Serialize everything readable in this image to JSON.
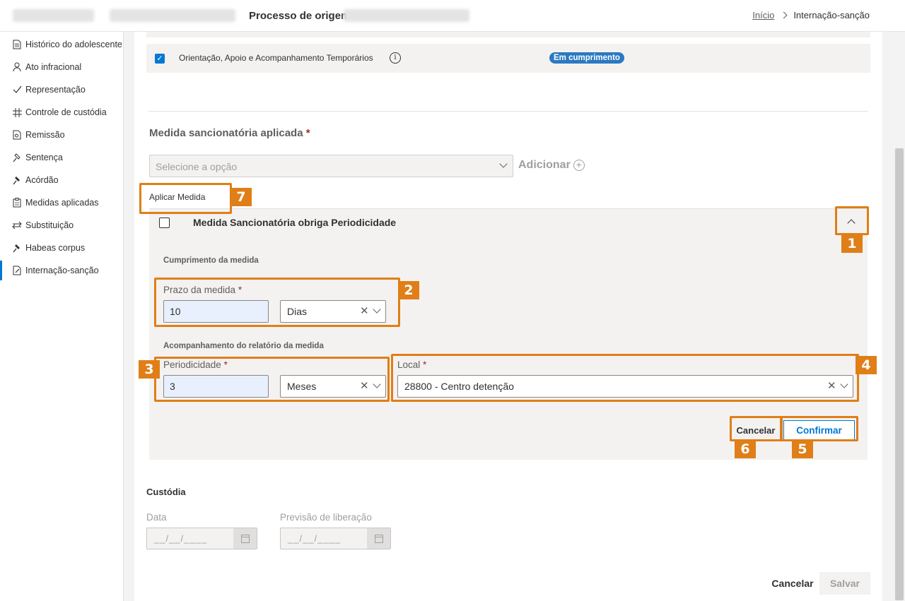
{
  "header": {
    "process_label": "Processo de origem:",
    "breadcrumb_home": "Início",
    "breadcrumb_current": "Internação-sanção"
  },
  "sidebar": {
    "items": [
      {
        "label": "Histórico do adolescente",
        "icon": "document-icon"
      },
      {
        "label": "Ato infracional",
        "icon": "person-icon"
      },
      {
        "label": "Representação",
        "icon": "checkmark-icon"
      },
      {
        "label": "Controle de custódia",
        "icon": "grid-icon"
      },
      {
        "label": "Remissão",
        "icon": "document-search-icon"
      },
      {
        "label": "Sentença",
        "icon": "gavel-icon"
      },
      {
        "label": "Acórdão",
        "icon": "gavel-filled-icon"
      },
      {
        "label": "Medidas aplicadas",
        "icon": "clipboard-icon"
      },
      {
        "label": "Substituição",
        "icon": "swap-icon"
      },
      {
        "label": "Habeas corpus",
        "icon": "gavel-filled-icon"
      },
      {
        "label": "Internação-sanção",
        "icon": "edit-document-icon",
        "active": true
      }
    ]
  },
  "existing_measure": {
    "label": "Orientação, Apoio e Acompanhamento Temporários",
    "checked": true,
    "status": "Em cumprimento"
  },
  "measure_section": {
    "title": "Medida sancionatória aplicada",
    "required_mark": "*",
    "select_placeholder": "Selecione a opção",
    "add_label": "Adicionar",
    "apply_label": "Aplicar Medida"
  },
  "panel": {
    "title": "Medida Sancionatória obriga Periodicidade",
    "checked": false,
    "compliance_heading": "Cumprimento da medida",
    "term_label": "Prazo da medida",
    "term_value": "10",
    "term_unit": "Dias",
    "report_heading": "Acompanhamento do relatório da medida",
    "periodicity_label": "Periodicidade",
    "periodicity_value": "3",
    "periodicity_unit": "Meses",
    "location_label": "Local",
    "location_value": "28800 - Centro detenção",
    "cancel_label": "Cancelar",
    "confirm_label": "Confirmar"
  },
  "custody": {
    "title": "Custódia",
    "date_label": "Data",
    "release_label": "Previsão de liberação",
    "date_mask": "__/__/____"
  },
  "footer": {
    "cancel_label": "Cancelar",
    "save_label": "Salvar"
  },
  "annotations": [
    "1",
    "2",
    "3",
    "4",
    "5",
    "6",
    "7"
  ],
  "colors": {
    "accent": "#0078d4",
    "annotation": "#e07e17",
    "badge": "#2b79c2",
    "required": "#a4262c"
  }
}
